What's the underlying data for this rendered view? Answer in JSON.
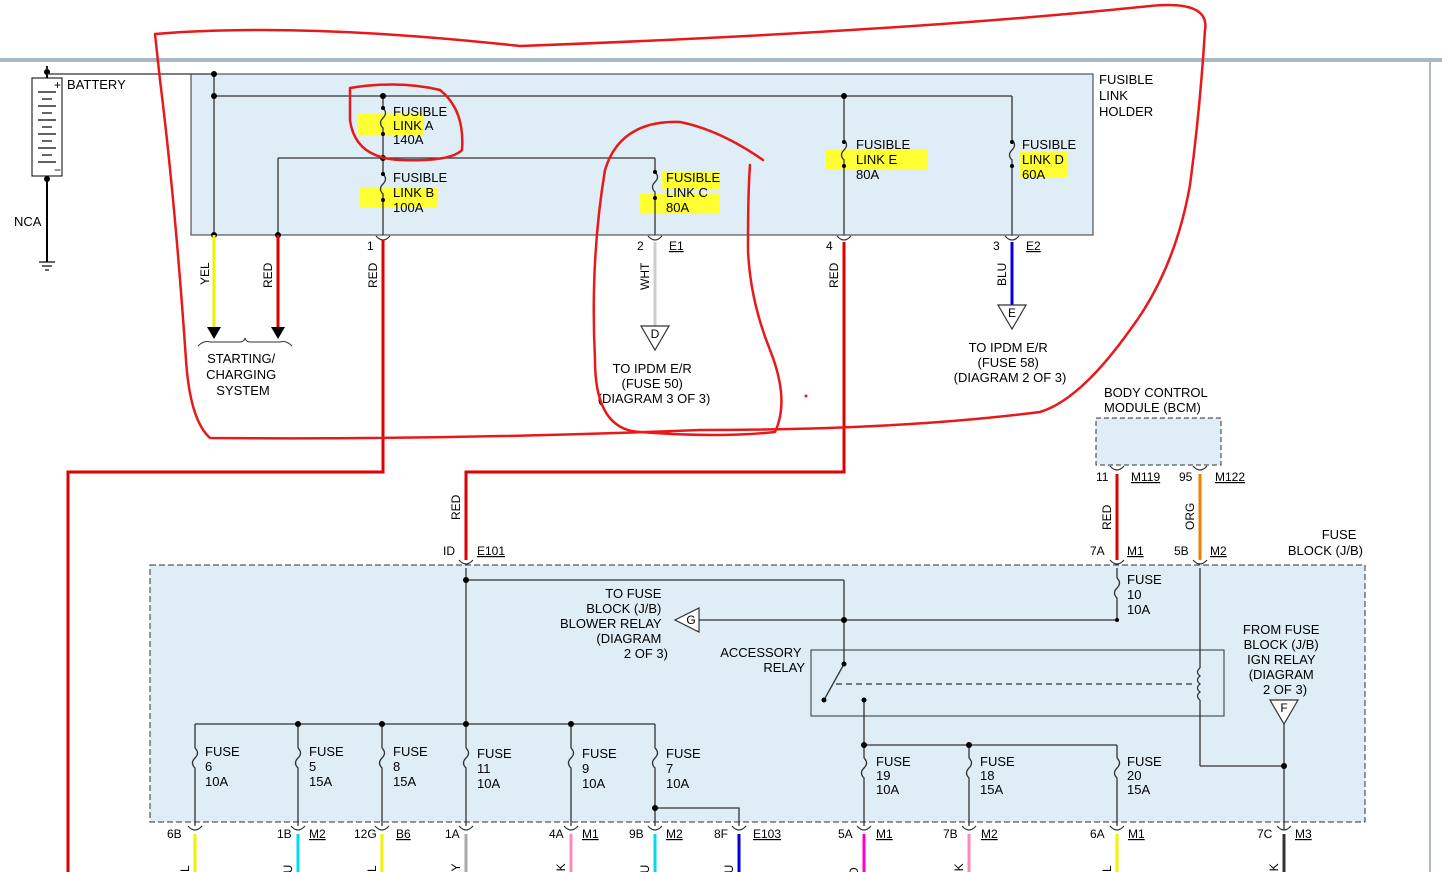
{
  "battery": {
    "label": "BATTERY",
    "plus": "+",
    "minus": "−",
    "ground_label": "NCA"
  },
  "fusible_holder": {
    "label": [
      "FUSIBLE",
      "LINK",
      "HOLDER"
    ]
  },
  "fusible_links": [
    {
      "id": "A",
      "lines": [
        "FUSIBLE",
        "LINK A",
        "140A"
      ]
    },
    {
      "id": "B",
      "lines": [
        "FUSIBLE",
        "LINK B",
        "100A"
      ]
    },
    {
      "id": "C",
      "lines": [
        "FUSIBLE",
        "LINK C",
        "80A"
      ]
    },
    {
      "id": "E",
      "lines": [
        "FUSIBLE",
        "LINK E",
        "80A"
      ]
    },
    {
      "id": "D",
      "lines": [
        "FUSIBLE",
        "LINK D",
        "60A"
      ]
    }
  ],
  "holder_terminals": {
    "t1": "1",
    "t2": "2",
    "t2_conn": "E1",
    "t4": "4",
    "t3": "3",
    "t3_conn": "E2"
  },
  "wires": {
    "yel": "YEL",
    "red": "RED",
    "wht": "WHT",
    "blu": "BLU",
    "org": "ORG"
  },
  "starting_system": [
    "STARTING/",
    "CHARGING",
    "SYSTEM"
  ],
  "ipdm_fuse50": {
    "letter": "D",
    "lines": [
      "TO IPDM E/R",
      "(FUSE 50)",
      "(DIAGRAM 3 OF 3)"
    ]
  },
  "ipdm_fuse58": {
    "letter": "E",
    "lines": [
      "TO IPDM E/R",
      "(FUSE 58)",
      "(DIAGRAM 2 OF 3)"
    ]
  },
  "bcm": {
    "lines": [
      "BODY CONTROL",
      "MODULE (BCM)"
    ],
    "pin1": "11",
    "pin1_conn": "M119",
    "pin2": "95",
    "pin2_conn": "M122"
  },
  "fuse_block": {
    "label": [
      "FUSE",
      "BLOCK (J/B)"
    ],
    "top_terms": {
      "id": "ID",
      "id_conn": "E101",
      "t7a": "7A",
      "t7a_conn": "M1",
      "t5b": "5B",
      "t5b_conn": "M2"
    },
    "blower": {
      "letter": "G",
      "lines": [
        "TO FUSE",
        "BLOCK (J/B)",
        "BLOWER RELAY",
        "(DIAGRAM",
        "2 OF 3)"
      ]
    },
    "accessory_relay": [
      "ACCESSORY",
      "RELAY"
    ],
    "ign_relay": {
      "letter": "F",
      "lines": [
        "FROM FUSE",
        "BLOCK (J/B)",
        "IGN RELAY",
        "(DIAGRAM",
        "2 OF 3)"
      ]
    },
    "fuses": [
      {
        "lines": [
          "FUSE",
          "10",
          "10A"
        ]
      },
      {
        "lines": [
          "FUSE",
          "6",
          "10A"
        ]
      },
      {
        "lines": [
          "FUSE",
          "5",
          "15A"
        ]
      },
      {
        "lines": [
          "FUSE",
          "8",
          "15A"
        ]
      },
      {
        "lines": [
          "FUSE",
          "11",
          "10A"
        ]
      },
      {
        "lines": [
          "FUSE",
          "9",
          "10A"
        ]
      },
      {
        "lines": [
          "FUSE",
          "7",
          "10A"
        ]
      },
      {
        "lines": [
          "FUSE",
          "19",
          "10A"
        ]
      },
      {
        "lines": [
          "FUSE",
          "18",
          "15A"
        ]
      },
      {
        "lines": [
          "FUSE",
          "20",
          "15A"
        ]
      }
    ],
    "bottom_terms": [
      {
        "pin": "6B",
        "conn": "",
        "wire": "EL"
      },
      {
        "pin": "1B",
        "conn": "M2",
        "wire": "LU"
      },
      {
        "pin": "12G",
        "conn": "B6",
        "wire": "EL"
      },
      {
        "pin": "1A",
        "conn": "",
        "wire": "RY"
      },
      {
        "pin": "4A",
        "conn": "M1",
        "wire": "NK"
      },
      {
        "pin": "9B",
        "conn": "M2",
        "wire": "LU"
      },
      {
        "pin": "8F",
        "conn": "E103",
        "wire": "LU"
      },
      {
        "pin": "5A",
        "conn": "M1",
        "wire": "IO"
      },
      {
        "pin": "7B",
        "conn": "M2",
        "wire": "NK"
      },
      {
        "pin": "6A",
        "conn": "M1",
        "wire": "EL"
      },
      {
        "pin": "7C",
        "conn": "M3",
        "wire": "NK"
      }
    ]
  },
  "colors": {
    "red": "#e00000",
    "yellow": "#f2f200",
    "white_wire": "#cccccc",
    "blue": "#0000e0",
    "orange": "#f08000",
    "pink": "#ff88bb",
    "cyan": "#00dde8",
    "magenta": "#ff00cc",
    "gray": "#aaaaaa",
    "dark": "#333333",
    "box_fill": "#deedf6",
    "highlight": "#ffff33",
    "annotation": "#e8191a"
  }
}
